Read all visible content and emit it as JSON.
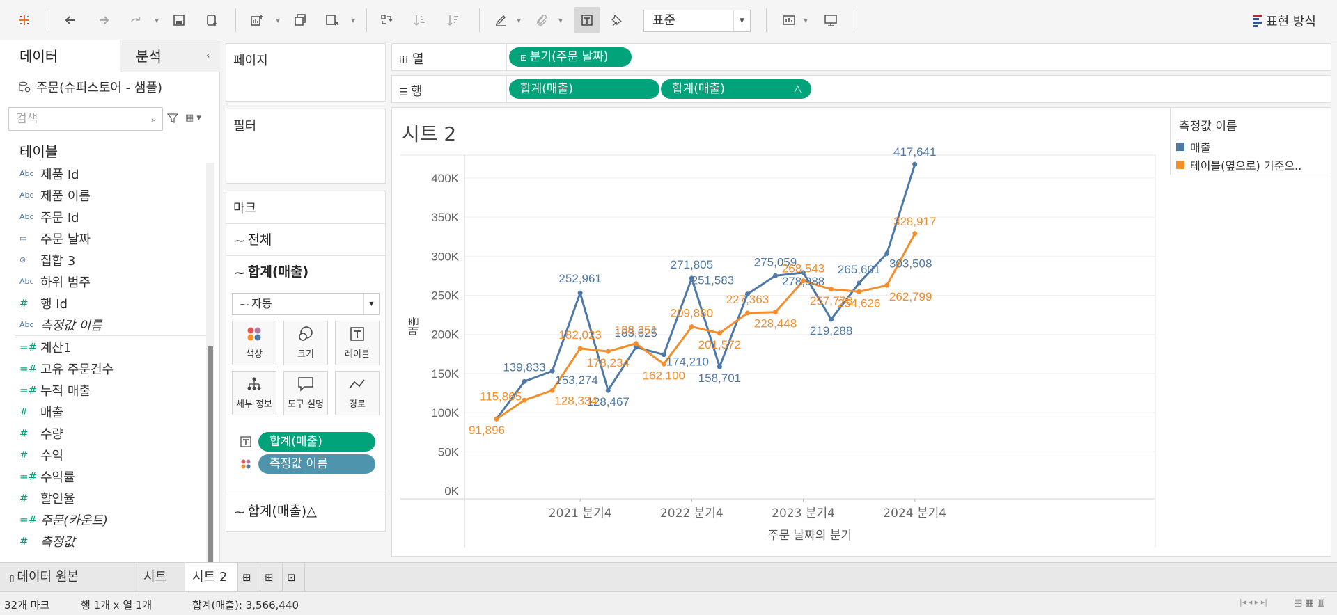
{
  "toolbar": {
    "format_select": "표준",
    "show_me": "표현 방식"
  },
  "data_pane": {
    "tab_data": "데이터",
    "tab_analysis": "분석",
    "datasource": "주문(슈퍼스토어 - 샘플)",
    "search_placeholder": "검색",
    "tables_title": "테이블",
    "fields": [
      {
        "icon": "Abc",
        "label": "제품 Id"
      },
      {
        "icon": "Abc",
        "label": "제품 이름"
      },
      {
        "icon": "Abc",
        "label": "주문 Id"
      },
      {
        "icon": "cal",
        "label": "주문 날짜"
      },
      {
        "icon": "set",
        "label": "집합 3"
      },
      {
        "icon": "Abc",
        "label": "하위 범주"
      },
      {
        "icon": "#",
        "label": "행 Id"
      },
      {
        "icon": "Abc",
        "label": "측정값 이름"
      },
      {
        "icon": "=#",
        "label": "계산1"
      },
      {
        "icon": "=#",
        "label": "고유 주문건수"
      },
      {
        "icon": "=#",
        "label": "누적 매출"
      },
      {
        "icon": "#",
        "label": "매출"
      },
      {
        "icon": "#",
        "label": "수량"
      },
      {
        "icon": "#",
        "label": "수익"
      },
      {
        "icon": "=#",
        "label": "수익률"
      },
      {
        "icon": "#",
        "label": "할인율"
      },
      {
        "icon": "=#",
        "label": "주문(카운트)"
      },
      {
        "icon": "#",
        "label": "측정값"
      }
    ]
  },
  "shelves": {
    "pages": "페이지",
    "filters": "필터",
    "marks": "마크",
    "columns_label": "열",
    "rows_label": "행",
    "column_pill": "분기(주문 날짜)",
    "row_pill_1": "합계(매출)",
    "row_pill_2": "합계(매출)",
    "delta_symbol": "△"
  },
  "marks": {
    "all": "전체",
    "sum_sales": "합계(매출)",
    "mark_type": "자동",
    "buttons": [
      "색상",
      "크기",
      "레이블",
      "세부 정보",
      "도구 설명",
      "경로"
    ],
    "pill_label": "합계(매출)",
    "pill_color": "측정값 이름",
    "sum_sales_delta": "합계(매출)△"
  },
  "view": {
    "sheet_title": "시트 2"
  },
  "legend": {
    "title": "측정값 이름",
    "items": [
      {
        "label": "매출",
        "color": "#4e79a7"
      },
      {
        "label": "테이블(옆으로) 기준으..",
        "color": "#f28e2b"
      }
    ]
  },
  "chart_data": {
    "type": "line",
    "title": "",
    "xlabel": "주문 날짜의 분기",
    "ylabel": "매출",
    "ylim": [
      0,
      420000
    ],
    "y_ticks": [
      "0K",
      "50K",
      "100K",
      "150K",
      "200K",
      "250K",
      "300K",
      "350K",
      "400K"
    ],
    "x_ticks": [
      "2021 분기4",
      "2022 분기4",
      "2023 분기4",
      "2024 분기4"
    ],
    "grid": true,
    "series": [
      {
        "name": "매출",
        "color": "#4e79a7",
        "values": [
          91896,
          139833,
          153274,
          252961,
          128467,
          183625,
          174210,
          271805,
          158701,
          251583,
          275059,
          278988,
          219288,
          265601,
          303508,
          417641
        ],
        "labels": [
          "",
          "139,833",
          "153,274",
          "252,961",
          "128,467",
          "183,625",
          "174,210",
          "271,805",
          "158,701",
          "251,583",
          "275,059",
          "278,988",
          "219,288",
          "265,601",
          "303,508",
          "417,641"
        ]
      },
      {
        "name": "테이블(옆으로) 기준으..",
        "color": "#f28e2b",
        "values": [
          91896,
          115865,
          128334,
          182023,
          178234,
          188351,
          162100,
          209880,
          201572,
          227363,
          228448,
          268543,
          257778,
          254626,
          262799,
          328917
        ],
        "labels": [
          "91,896",
          "115,865",
          "128,334",
          "182,023",
          "178,234",
          "188,351",
          "162,100",
          "209,880",
          "201,572",
          "227,363",
          "228,448",
          "268,543",
          "257,778",
          "254,626",
          "262,799",
          "328,917"
        ]
      }
    ]
  },
  "sheet_tabs": {
    "datasource_tab": "데이터 원본",
    "tabs": [
      "시트 1",
      "시트 2"
    ]
  },
  "status_bar": {
    "marks": "32개 마크",
    "rows_cols": "행 1개 x 열 1개",
    "sum": "합계(매출): 3,566,440"
  }
}
